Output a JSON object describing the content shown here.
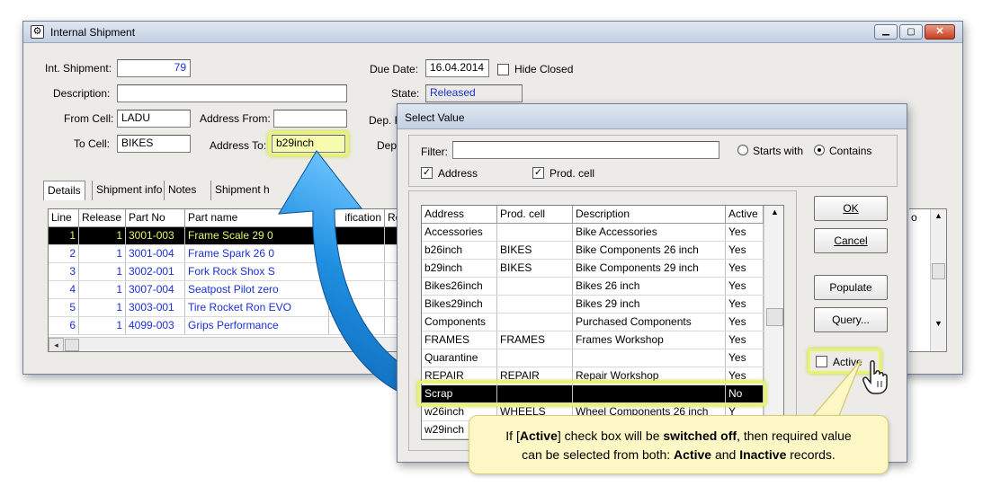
{
  "main_window": {
    "title": "Internal Shipment",
    "int_shipment_label": "Int. Shipment:",
    "int_shipment_value": "79",
    "description_label": "Description:",
    "description_value": "",
    "from_cell_label": "From Cell:",
    "from_cell_value": "LADU",
    "address_from_label": "Address From:",
    "address_from_value": "",
    "to_cell_label": "To Cell:",
    "to_cell_value": "BIKES",
    "address_to_label": "Address To:",
    "address_to_value": "b29inch",
    "due_date_label": "Due Date:",
    "due_date_value": "16.04.2014",
    "hide_closed_label": "Hide Closed",
    "state_label": "State:",
    "state_value": "Released",
    "dep_label_1": "Dep. F",
    "dep_label_2": "Dep",
    "tabs": [
      "Details",
      "Shipment info",
      "Notes",
      "Shipment h"
    ],
    "grid_headers": [
      "Line",
      "Release",
      "Part No",
      "Part name",
      "ification",
      "Re"
    ],
    "grid_rows": [
      {
        "line": "1",
        "release": "1",
        "part_no": "3001-003",
        "part_name": "Frame Scale 29 0"
      },
      {
        "line": "2",
        "release": "1",
        "part_no": "3001-004",
        "part_name": "Frame Spark 26 0"
      },
      {
        "line": "3",
        "release": "1",
        "part_no": "3002-001",
        "part_name": "Fork Rock Shox S"
      },
      {
        "line": "4",
        "release": "1",
        "part_no": "3007-004",
        "part_name": "Seatpost Pilot zero"
      },
      {
        "line": "5",
        "release": "1",
        "part_no": "3003-001",
        "part_name": "Tire Rocket Ron EVO"
      },
      {
        "line": "6",
        "release": "1",
        "part_no": "4099-003",
        "part_name": "Grips Performance"
      }
    ],
    "right_partial_header": "o"
  },
  "dialog": {
    "title": "Select Value",
    "filter_label": "Filter:",
    "filter_value": "",
    "starts_with_label": "Starts with",
    "contains_label": "Contains",
    "address_chk_label": "Address",
    "prod_cell_chk_label": "Prod. cell",
    "headers": [
      "Address",
      "Prod. cell",
      "Description",
      "Active"
    ],
    "rows": [
      {
        "address": "Accessories",
        "prod_cell": "",
        "description": "Bike Accessories",
        "active": "Yes"
      },
      {
        "address": "b26inch",
        "prod_cell": "BIKES",
        "description": "Bike Components 26 inch",
        "active": "Yes"
      },
      {
        "address": "b29inch",
        "prod_cell": "BIKES",
        "description": "Bike Components 29 inch",
        "active": "Yes"
      },
      {
        "address": "Bikes26inch",
        "prod_cell": "",
        "description": "Bikes 26 inch",
        "active": "Yes"
      },
      {
        "address": "Bikes29inch",
        "prod_cell": "",
        "description": "Bikes 29 inch",
        "active": "Yes"
      },
      {
        "address": "Components",
        "prod_cell": "",
        "description": "Purchased Components",
        "active": "Yes"
      },
      {
        "address": "FRAMES",
        "prod_cell": "FRAMES",
        "description": "Frames Workshop",
        "active": "Yes"
      },
      {
        "address": "Quarantine",
        "prod_cell": "",
        "description": "",
        "active": "Yes"
      },
      {
        "address": "REPAIR",
        "prod_cell": "REPAIR",
        "description": "Repair Workshop",
        "active": "Yes"
      },
      {
        "address": "Scrap",
        "prod_cell": "",
        "description": "",
        "active": "No"
      },
      {
        "address": "w26inch",
        "prod_cell": "WHEELS",
        "description": "Wheel Components 26 inch",
        "active": "Y"
      },
      {
        "address": "w29inch",
        "prod_cell": "",
        "description": "",
        "active": ""
      }
    ],
    "ok_label": "OK",
    "cancel_label": "Cancel",
    "populate_label": "Populate",
    "query_label": "Query...",
    "active_chk_label": "Active"
  },
  "callout": {
    "t1": "If [",
    "t2": "Active",
    "t3": "] check box will be ",
    "t4": "switched off",
    "t5": ", then required value",
    "t6": "can be selected from both: ",
    "t7": "Active",
    "t8": " and ",
    "t9": "Inactive",
    "t10": " records."
  },
  "colors": {
    "highlight": "#e8f56a",
    "selected_row": "#000000",
    "callout_bg": "#fdf7c6",
    "arrow_blue": "#1f8fe0",
    "link_blue": "#1a2fd0"
  }
}
